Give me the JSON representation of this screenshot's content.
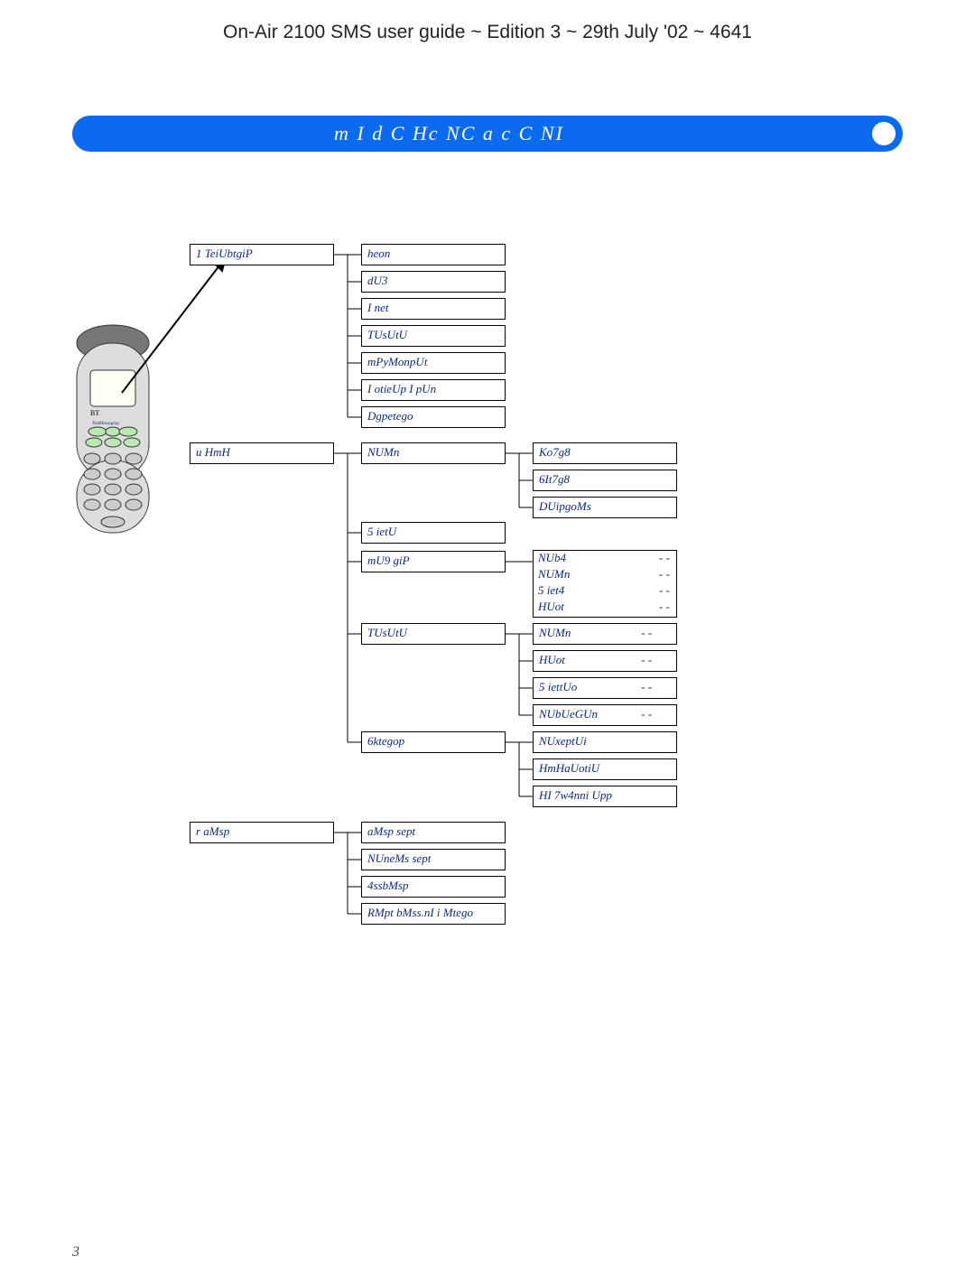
{
  "header": "On-Air 2100 SMS user guide ~ Edition 3 ~ 29th July '02 ~ 4641",
  "banner_title": "m I d C   Hc NC a c C NI",
  "page_number": "3",
  "menu": {
    "group1": {
      "root": "1 TeiUbtgiP",
      "children": [
        "heon",
        "dU3",
        "I net",
        "TUsUtU",
        "mPyMonpUt",
        "I otieUp I pUn",
        "Dgpetego"
      ]
    },
    "group2": {
      "root": "u HmH",
      "children": [
        "NUMn",
        "5 ietU",
        "mU9 giP",
        "TUsUtU",
        "6ktegop"
      ],
      "sub_num": {
        "items": [
          "Ko7g8",
          "6It7g8",
          "DUipgoMs"
        ]
      },
      "sub_mu9": {
        "items": [
          {
            "l": "NUb4",
            "r": "- -"
          },
          {
            "l": "NUMn",
            "r": "- -"
          },
          {
            "l": "5 iet4",
            "r": "- -"
          },
          {
            "l": "HUot",
            "r": "- -"
          }
        ]
      },
      "sub_tus": {
        "items": [
          {
            "l": "NUMn",
            "r": "- -"
          },
          {
            "l": "HUot",
            "r": "- -"
          },
          {
            "l": "5 iettUo",
            "r": "- -"
          },
          {
            "l": "NUbUeGUn",
            "r": "- -"
          }
        ]
      },
      "sub_6kt": {
        "items": [
          "NUxeptUi",
          "HmHaUotiU",
          "HI 7w4nni Upp"
        ]
      }
    },
    "group3": {
      "root": "r aMsp",
      "children": [
        "aMsp sept",
        "NUneMs sept",
        "4ssbMsp",
        "RMpt bMss.nI i Mtego"
      ]
    }
  }
}
